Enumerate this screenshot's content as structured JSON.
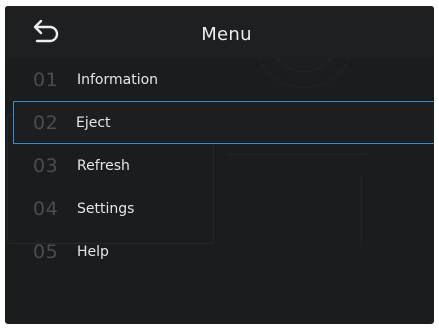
{
  "header": {
    "title": "Menu",
    "back_icon": "back-arrow-icon"
  },
  "menu": {
    "selected_index": 1,
    "items": [
      {
        "number": "01",
        "label": "Information"
      },
      {
        "number": "02",
        "label": "Eject"
      },
      {
        "number": "03",
        "label": "Refresh"
      },
      {
        "number": "04",
        "label": "Settings"
      },
      {
        "number": "05",
        "label": "Help"
      }
    ]
  },
  "colors": {
    "background": "#1b1c1e",
    "selection_border": "#2f8fd6",
    "text": "#e6e6e6",
    "number_text": "#4b4c50"
  }
}
